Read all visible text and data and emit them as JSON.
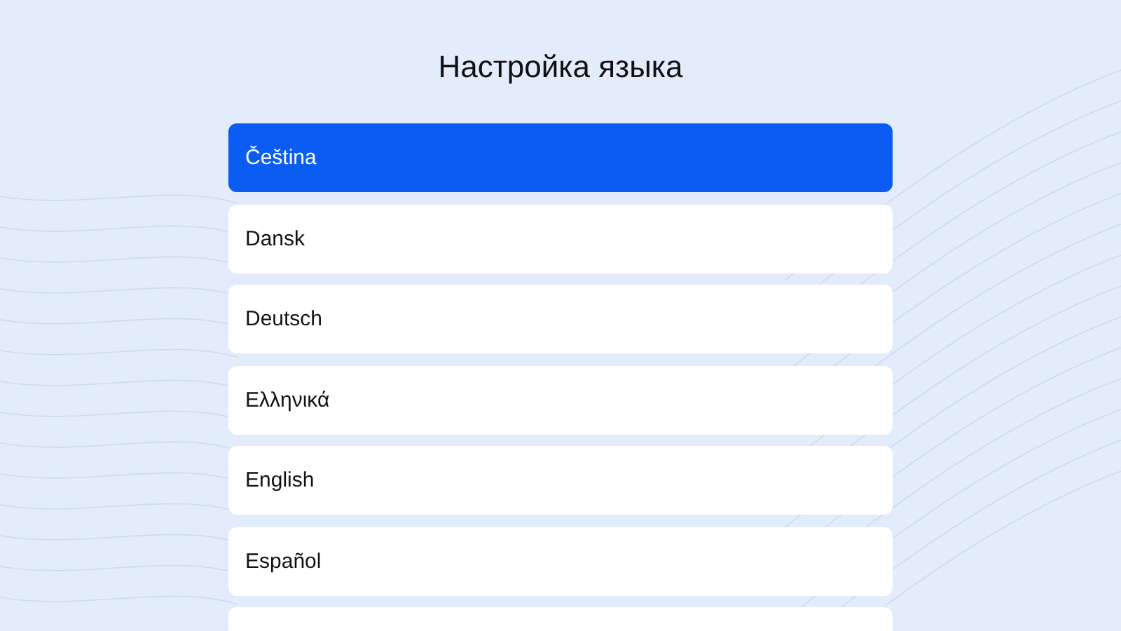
{
  "title": "Настройка языка",
  "languages": [
    {
      "label": "Čeština",
      "selected": true
    },
    {
      "label": "Dansk",
      "selected": false
    },
    {
      "label": "Deutsch",
      "selected": false
    },
    {
      "label": "Ελληνικά",
      "selected": false
    },
    {
      "label": "English",
      "selected": false
    },
    {
      "label": "Español",
      "selected": false
    }
  ]
}
